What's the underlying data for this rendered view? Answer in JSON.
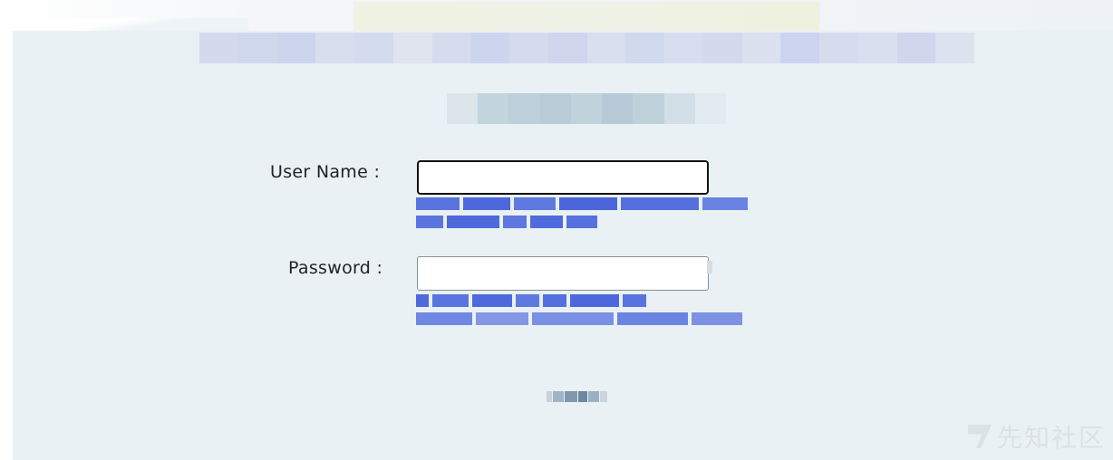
{
  "form": {
    "username_label": "User Name :",
    "username_value": "",
    "password_label": "Password :",
    "password_value": ""
  },
  "watermark": {
    "text": "先知社区",
    "icon": "xianzhi-logo-icon"
  },
  "redacted": {
    "banner": true,
    "heading": true,
    "username_hint": true,
    "password_hint": true,
    "submit_label": true
  },
  "colors": {
    "panel_background": "#e9f1f4",
    "hint_text": "#3f5fe0",
    "active_input_border": "#111111"
  }
}
